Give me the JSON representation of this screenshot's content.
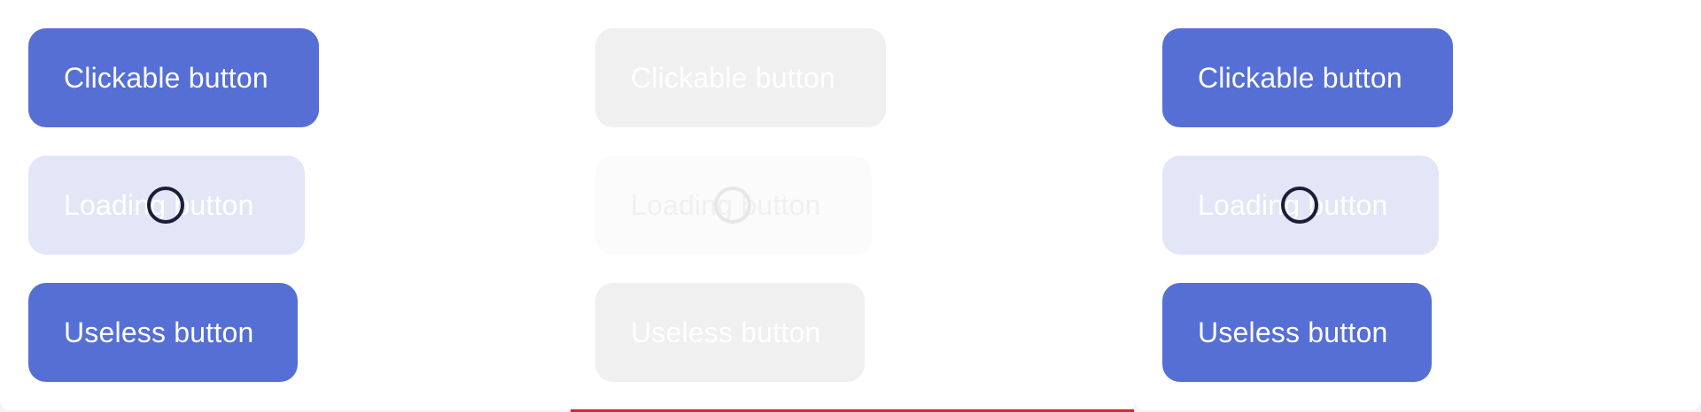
{
  "colors": {
    "primary": "#556fd5",
    "loading_bg": "#e3e6f6",
    "disabled_bg": "#f0f0f0",
    "spinner_dark": "#1b1e3a",
    "accent_line": "#d9262c"
  },
  "panels": [
    {
      "state": "enabled",
      "clickable_label": "Clickable button",
      "loading_label": "Loading button",
      "useless_label": "Useless button"
    },
    {
      "state": "disabled",
      "clickable_label": "Clickable button",
      "loading_label": "Loading button",
      "useless_label": "Useless button"
    },
    {
      "state": "enabled",
      "clickable_label": "Clickable button",
      "loading_label": "Loading button",
      "useless_label": "Useless button"
    }
  ]
}
